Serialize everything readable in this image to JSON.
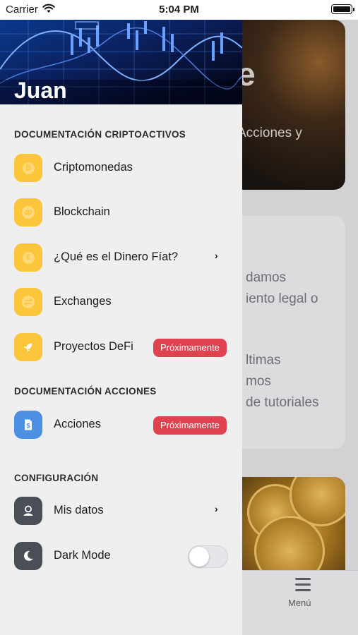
{
  "status_bar": {
    "carrier": "Carrier",
    "time": "5:04 PM"
  },
  "drawer": {
    "user_name": "Juan",
    "sections": [
      {
        "title": "DOCUMENTACIÓN CRIPTOACTIVOS",
        "items": [
          {
            "label": "Criptomonedas",
            "icon": "bitcoin-icon"
          },
          {
            "label": "Blockchain",
            "icon": "link-icon"
          },
          {
            "label": "¿Qué es el Dinero Fíat?",
            "icon": "euro-icon",
            "chevron": "›"
          },
          {
            "label": "Exchanges",
            "icon": "exchange-arrows-icon"
          },
          {
            "label": "Proyectos DeFi",
            "icon": "rocket-icon",
            "badge": "Próximamente"
          }
        ]
      },
      {
        "title": "DOCUMENTACIÓN ACCIONES",
        "items": [
          {
            "label": "Acciones",
            "icon": "dollar-document-icon",
            "badge": "Próximamente"
          }
        ]
      },
      {
        "title": "CONFIGURACIÓN",
        "items": [
          {
            "label": "Mis datos",
            "icon": "user-icon",
            "chevron": "›"
          },
          {
            "label": "Dark Mode",
            "icon": "moon-icon",
            "toggle_on": false
          }
        ]
      }
    ]
  },
  "background": {
    "card1_big": "e",
    "card1_sub": "Acciones y",
    "card2_lines": [
      "damos",
      "iento legal o",
      "ltimas",
      "mos",
      "de tutoriales"
    ],
    "tab_menu_label": "Menú"
  },
  "colors": {
    "accent_yellow": "#fcc53a",
    "accent_blue": "#4d8fe0",
    "icon_dark": "#4a4f57",
    "badge_red": "#e1424f"
  }
}
